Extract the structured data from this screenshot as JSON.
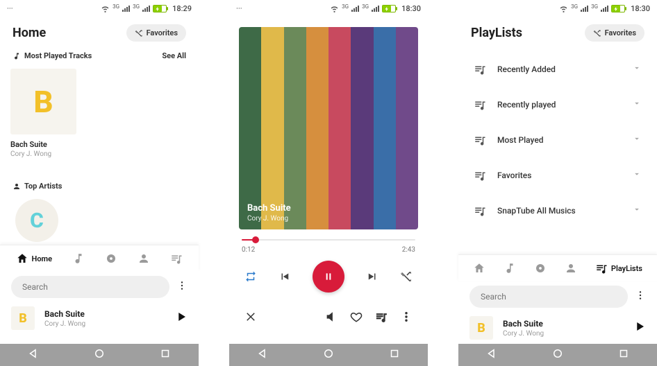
{
  "status": {
    "net_label": "3G",
    "time1": "18:29",
    "time2": "18:30",
    "time3": "18:30"
  },
  "home": {
    "title": "Home",
    "favorites_label": "Favorites",
    "section_most_played": "Most Played Tracks",
    "see_all": "See All",
    "tile_title": "Bach Suite",
    "tile_artist": "Cory J. Wong",
    "tile_letter": "B",
    "section_top_artists": "Top Artists",
    "artist_letter": "C",
    "nav_home": "Home",
    "search_placeholder": "Search",
    "np_title": "Bach Suite",
    "np_artist": "Cory J. Wong",
    "np_letter": "B"
  },
  "player": {
    "title": "Bach Suite",
    "artist": "Cory J. Wong",
    "elapsed": "0:12",
    "total": "2:43",
    "progress_pct": 8,
    "stripe_colors": [
      "#3e6a47",
      "#e0b94a",
      "#6b8a5a",
      "#d68f3e",
      "#c84a5f",
      "#5a3a7a",
      "#3a6ea8",
      "#704a8a"
    ]
  },
  "playlists": {
    "title": "PlayLists",
    "favorites_label": "Favorites",
    "items": [
      {
        "label": "Recently Added"
      },
      {
        "label": "Recently played"
      },
      {
        "label": "Most Played"
      },
      {
        "label": "Favorites"
      },
      {
        "label": "SnapTube All Musics"
      }
    ],
    "nav_playlists": "PlayLists",
    "search_placeholder": "Search",
    "np_title": "Bach Suite",
    "np_artist": "Cory J. Wong",
    "np_letter": "B"
  }
}
